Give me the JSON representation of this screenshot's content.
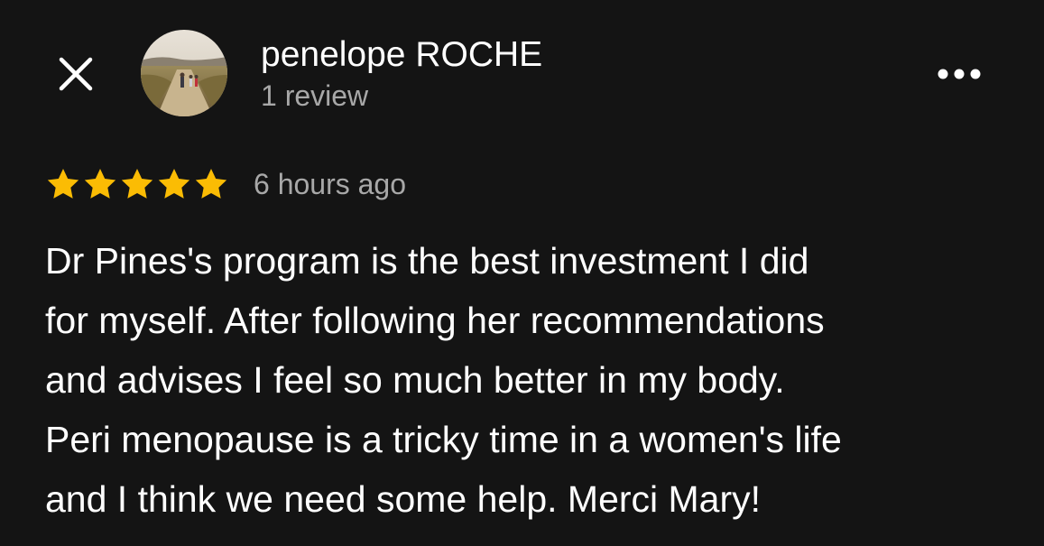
{
  "header": {
    "close_icon": "close-icon",
    "more_icon": "more-horizontal-icon"
  },
  "reviewer": {
    "name": "penelope ROCHE",
    "review_count": "1 review",
    "avatar_icon": "avatar-photo"
  },
  "review": {
    "rating": 5,
    "rating_max": 5,
    "star_color": "#fbbc04",
    "time": "6 hours ago",
    "text_lines": [
      "Dr Pines's program is the best investment I did",
      "for myself. After following her recommendations",
      "and advises I feel so much better in my body.",
      "Peri menopause is a tricky time in a women's life",
      "and I think we need some help. Merci Mary!"
    ]
  }
}
